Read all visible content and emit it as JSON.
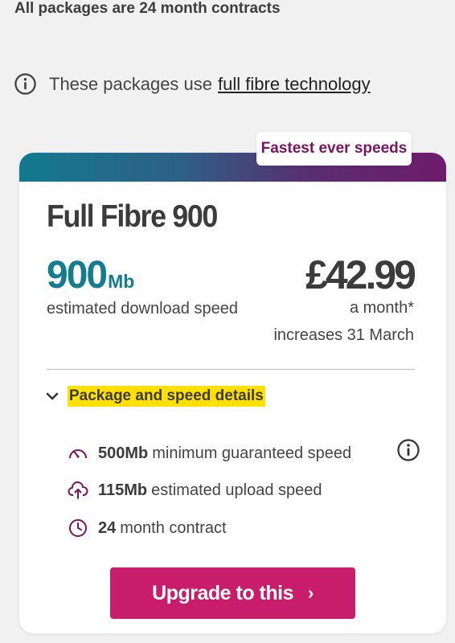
{
  "header": {
    "contract_note": "All packages are 24 month contracts",
    "info_text": "These packages use",
    "info_link": "full fibre technology"
  },
  "card": {
    "badge": "Fastest ever speeds",
    "title": "Full Fibre 900",
    "speed_value": "900",
    "speed_unit": "Mb",
    "speed_label": "estimated download speed",
    "price": "£42.99",
    "price_period": "a month*",
    "price_note": "increases 31 March",
    "details_label": "Package and speed details",
    "features": [
      {
        "value": "500Mb",
        "text": "minimum guaranteed speed",
        "icon": "speedometer-icon"
      },
      {
        "value": "115Mb",
        "text": "estimated upload speed",
        "icon": "upload-cloud-icon"
      },
      {
        "value": "24",
        "text": "month contract",
        "icon": "clock-icon"
      }
    ],
    "button_label": "Upgrade to this",
    "button_arrow": "›"
  },
  "colors": {
    "accent_teal": "#137d8f",
    "accent_purple": "#7a1363",
    "button_pink": "#c81d6b",
    "highlight_yellow": "#ffe000"
  }
}
